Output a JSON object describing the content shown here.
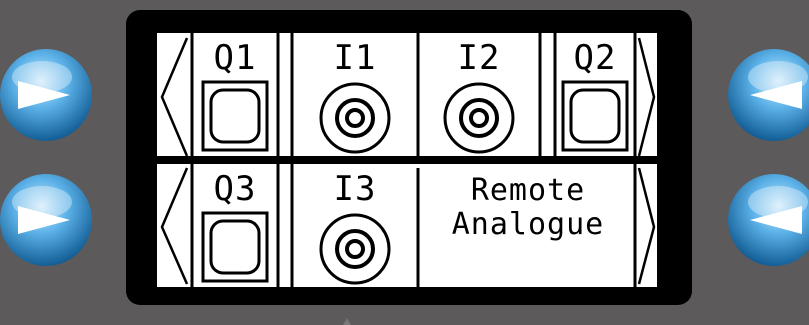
{
  "display": {
    "tiles": [
      {
        "id": "Q1",
        "label": "Q1",
        "icon": "square-button-icon"
      },
      {
        "id": "I1",
        "label": "I1",
        "icon": "concentric-circles-icon"
      },
      {
        "id": "I2",
        "label": "I2",
        "icon": "concentric-circles-icon"
      },
      {
        "id": "Q2",
        "label": "Q2",
        "icon": "square-button-icon"
      },
      {
        "id": "Q3",
        "label": "Q3",
        "icon": "square-button-icon"
      },
      {
        "id": "I3",
        "label": "I3",
        "icon": "concentric-circles-icon"
      }
    ],
    "remote": {
      "line1": "Remote",
      "line2": "Analogue"
    }
  },
  "buttons": {
    "left_top": {
      "icon": "play-right-icon"
    },
    "left_bottom": {
      "icon": "play-right-icon"
    },
    "right_top": {
      "icon": "play-left-icon"
    },
    "right_bottom": {
      "icon": "play-left-icon"
    }
  },
  "colors": {
    "panel": "#5c5a5b",
    "bezel": "#000000",
    "screen": "#ffffff",
    "button_blue": "#1f7fc4",
    "button_highlight": "#cfe9fb"
  }
}
